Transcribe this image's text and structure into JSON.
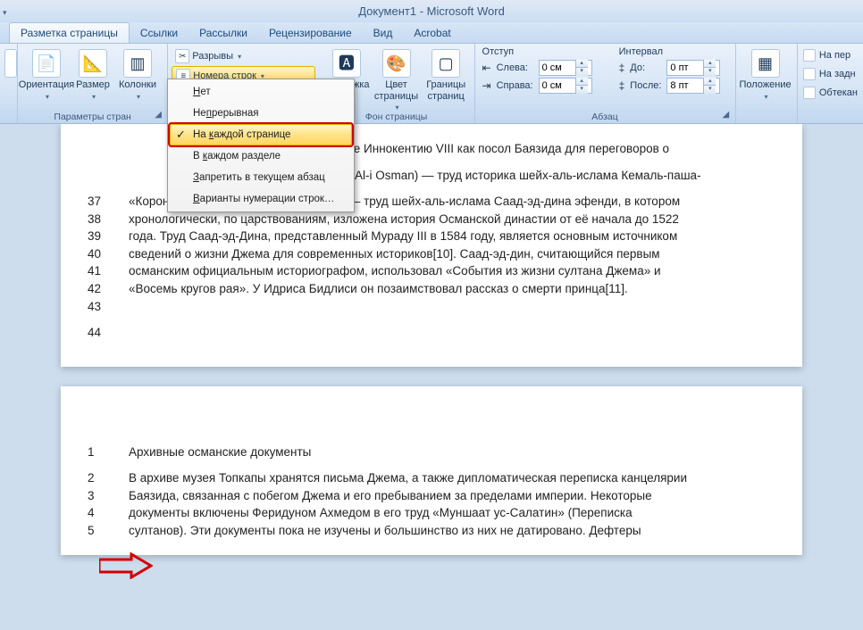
{
  "title": "Документ1 - Microsoft Word",
  "tabs": {
    "page_layout": "Разметка страницы",
    "references": "Ссылки",
    "mailings": "Рассылки",
    "review": "Рецензирование",
    "view": "Вид",
    "acrobat": "Acrobat"
  },
  "ribbon": {
    "orientation": "Ориентация",
    "size": "Размер",
    "columns": "Колонки",
    "breaks": "Разрывы",
    "line_numbers": "Номера строк",
    "watermark": "Подложка",
    "page_color": "Цвет страницы",
    "page_borders": "Границы страниц",
    "grp_page_setup": "Параметры стран",
    "grp_page_bg": "Фон страницы",
    "indent_head": "Отступ",
    "indent_left": "Слева:",
    "indent_right": "Справа:",
    "indent_left_val": "0 см",
    "indent_right_val": "0 см",
    "spacing_head": "Интервал",
    "spacing_before": "До:",
    "spacing_after": "После:",
    "spacing_before_val": "0 пт",
    "spacing_after_val": "8 пт",
    "grp_paragraph": "Абзац",
    "position": "Положение",
    "bring_front": "На пер",
    "send_back": "На задн",
    "wrap_text": "Обтекан"
  },
  "dropdown": {
    "none": "Нет",
    "continuous": "Непрерывная",
    "each_page": "На каждой странице",
    "each_section": "В каждом разделе",
    "suppress": "Запретить в текущем абзац",
    "options": "Варианты нумерации строк…",
    "u_none": "Н",
    "u_cont": "п",
    "u_page": "к",
    "u_sect": "к",
    "u_supp": "З",
    "u_opt": "В"
  },
  "page1": {
    "frag_top": "к папе Иннокентию VIII как посол Баязида для переговоров о",
    "frag_mid": "arih-i Al-i Osman) — труд историка шейх-аль-ислама Кемаль-паша-",
    "lines": [
      {
        "n": "37",
        "t": "«Корона летописей» (Tâcü't-Tevârih[tr]) — труд шейх-аль-ислама Саад-эд-дина эфенди, в котором"
      },
      {
        "n": "38",
        "t": "хронологически, по царствованиям, изложена история Османской династии от её начала до 1522"
      },
      {
        "n": "39",
        "t": "года. Труд Саад-эд-Дина, представленный Мураду III в 1584 году, является основным источником"
      },
      {
        "n": "40",
        "t": "сведений о жизни Джема для современных историков[10]. Саад-эд-дин, считающийся первым"
      },
      {
        "n": "41",
        "t": "османским официальным историографом, использовал «События из жизни султана Джема» и"
      },
      {
        "n": "42",
        "t": "«Восемь кругов рая». У Идриса Бидлиси он позаимствовал рассказ о смерти принца[11]."
      },
      {
        "n": "43",
        "t": ""
      },
      {
        "n": "44",
        "t": ""
      }
    ]
  },
  "page2": {
    "lines": [
      {
        "n": "1",
        "t": "Архивные османские документы"
      },
      {
        "n": "",
        "t": ""
      },
      {
        "n": "2",
        "t": "В архиве музея Топкапы хранятся письма Джема, а также дипломатическая переписка канцелярии"
      },
      {
        "n": "3",
        "t": "Баязида, связанная с побегом Джема и его пребыванием за пределами империи. Некоторые"
      },
      {
        "n": "4",
        "t": "документы включены Феридуном Ахмедом в его труд «Муншаат ус-Салатин» (Переписка"
      },
      {
        "n": "5",
        "t": "султанов). Эти документы пока не изучены и большинство из них не датировано. Дефтеры"
      }
    ]
  }
}
